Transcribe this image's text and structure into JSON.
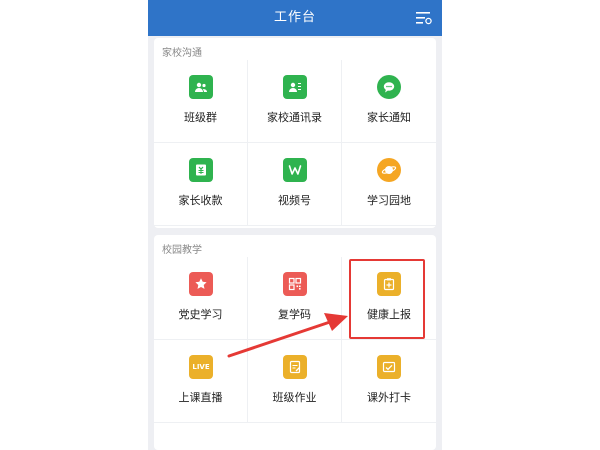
{
  "header": {
    "title": "工作台",
    "menu_icon": "filter-menu-icon"
  },
  "sections": [
    {
      "title": "家校沟通",
      "items": [
        {
          "label": "班级群",
          "icon": "class-group-icon",
          "color": "#2fb34f"
        },
        {
          "label": "家校通讯录",
          "icon": "contacts-icon",
          "color": "#2fb34f"
        },
        {
          "label": "家长通知",
          "icon": "chat-bubble-icon",
          "color": "#2fb34f"
        },
        {
          "label": "家长收款",
          "icon": "payment-icon",
          "color": "#2fb34f"
        },
        {
          "label": "视频号",
          "icon": "video-channel-icon",
          "color": "#2fb34f"
        },
        {
          "label": "学习园地",
          "icon": "planet-icon",
          "color": "#f5a623"
        }
      ]
    },
    {
      "title": "校园教学",
      "items": [
        {
          "label": "党史学习",
          "icon": "star-icon",
          "color": "#ec5b56"
        },
        {
          "label": "复学码",
          "icon": "qr-code-icon",
          "color": "#ec5b56"
        },
        {
          "label": "健康上报",
          "icon": "health-report-icon",
          "color": "#ebb02a"
        },
        {
          "label": "上课直播",
          "icon": "live-icon",
          "icon_text": "LIVE",
          "color": "#ebb02a"
        },
        {
          "label": "班级作业",
          "icon": "homework-icon",
          "color": "#ebb02a"
        },
        {
          "label": "课外打卡",
          "icon": "checkin-icon",
          "color": "#ebb02a"
        }
      ]
    }
  ],
  "annotation": {
    "highlight_color": "#e53935",
    "target": "健康上报"
  }
}
